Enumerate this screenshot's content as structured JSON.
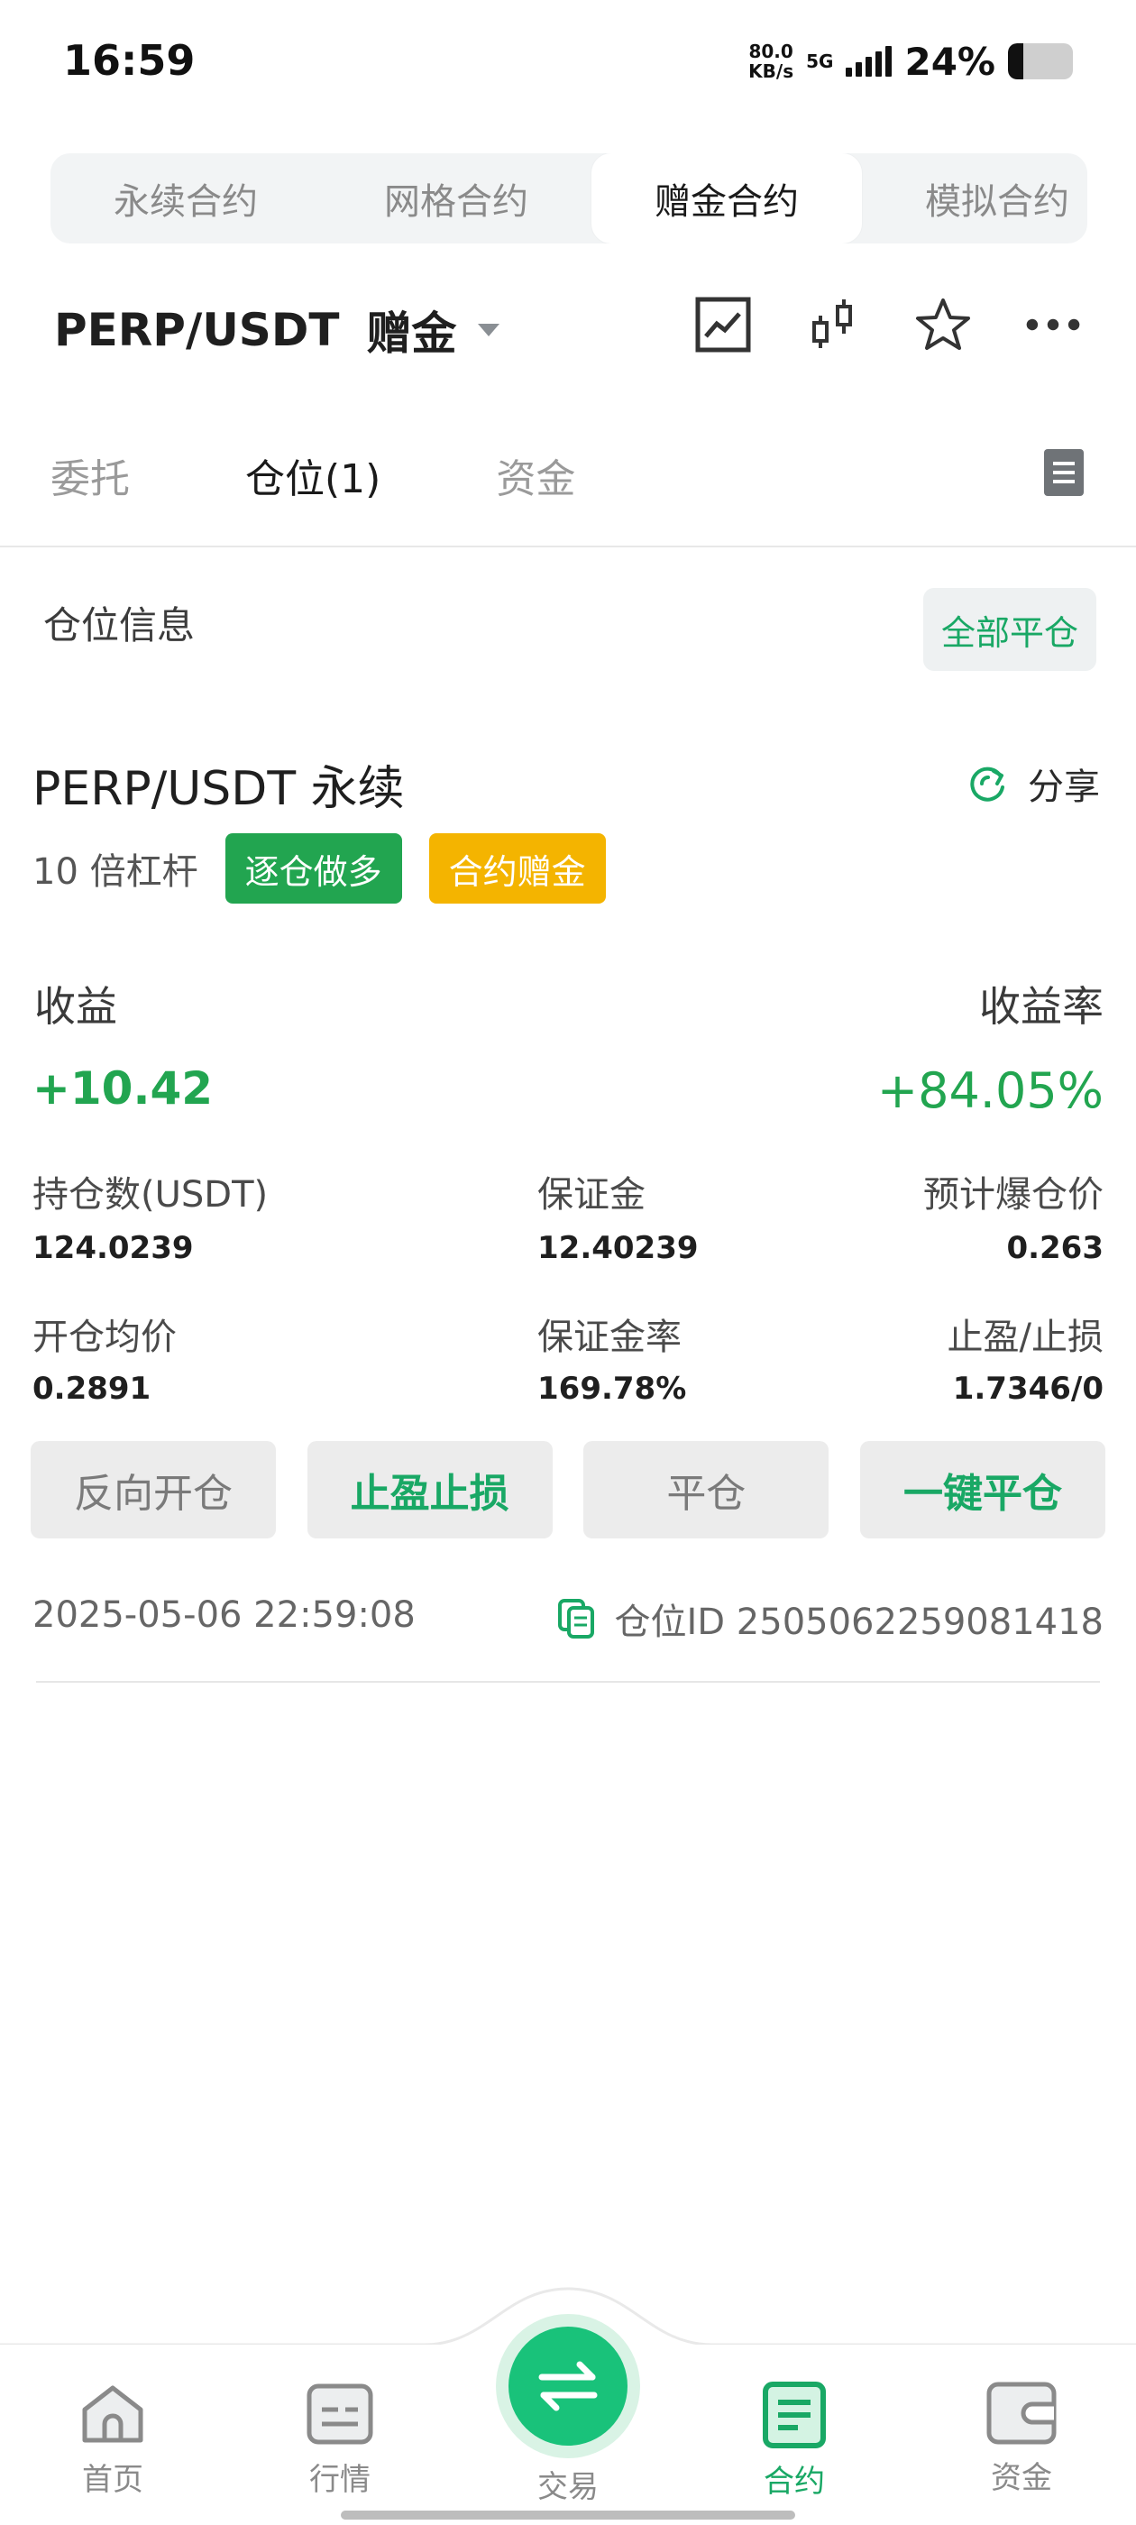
{
  "status": {
    "time": "16:59",
    "net_speed_value": "80.0",
    "net_speed_unit": "KB/s",
    "network": "5G",
    "battery_percent": "24%",
    "battery_level": 0.24
  },
  "type_tabs": [
    "永续合约",
    "网格合约",
    "赠金合约",
    "模拟合约"
  ],
  "type_tabs_active": 2,
  "header": {
    "pair": "PERP/USDT",
    "mode": "赠金",
    "icons": [
      "line-chart-icon",
      "candlestick-icon",
      "star-icon",
      "more-icon"
    ]
  },
  "sub_tabs": [
    "委托",
    "仓位(1)",
    "资金"
  ],
  "sub_tabs_active": 1,
  "section": {
    "title": "仓位信息",
    "close_all": "全部平仓"
  },
  "position": {
    "name": "PERP/USDT 永续",
    "share": "分享",
    "leverage": "10 倍杠杆",
    "tag_side": "逐仓做多",
    "tag_bonus": "合约赠金",
    "pnl_label": "收益",
    "pnl_rate_label": "收益率",
    "pnl": "+10.42",
    "pnl_rate": "+84.05%",
    "grid": [
      {
        "label": "持仓数(USDT)",
        "value": "124.0239"
      },
      {
        "label": "保证金",
        "value": "12.40239"
      },
      {
        "label": "预计爆仓价",
        "value": "0.263"
      },
      {
        "label": "开仓均价",
        "value": "0.2891"
      },
      {
        "label": "保证金率",
        "value": "169.78%"
      },
      {
        "label": "止盈/止损",
        "value": "1.7346/0"
      }
    ],
    "actions": [
      "反向开仓",
      "止盈止损",
      "平仓",
      "一键平仓"
    ],
    "open_time": "2025-05-06 22:59:08",
    "position_id": "仓位ID 2505062259081418"
  },
  "nav": {
    "items": [
      "首页",
      "行情",
      "交易",
      "合约",
      "资金"
    ],
    "active": 3
  },
  "colors": {
    "accent_green": "#19a865",
    "profit_green": "#22a550",
    "bonus_yellow": "#f4b400"
  }
}
